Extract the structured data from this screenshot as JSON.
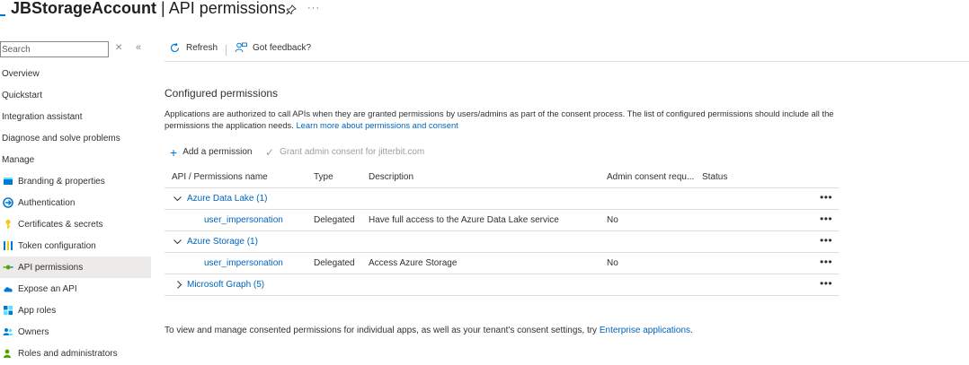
{
  "header": {
    "resource_name": "JBStorageAccount",
    "separator": " | ",
    "page_name": "API permissions",
    "more_label": "···"
  },
  "sidebar": {
    "search_placeholder": "Search",
    "items": [
      {
        "label": "Overview",
        "icon": "none"
      },
      {
        "label": "Quickstart",
        "icon": "none"
      },
      {
        "label": "Integration assistant",
        "icon": "none"
      },
      {
        "label": "Diagnose and solve problems",
        "icon": "none"
      },
      {
        "label": "Manage",
        "icon": "none"
      },
      {
        "label": "Branding & properties",
        "icon": "branding-icon"
      },
      {
        "label": "Authentication",
        "icon": "authentication-icon"
      },
      {
        "label": "Certificates & secrets",
        "icon": "key-icon"
      },
      {
        "label": "Token configuration",
        "icon": "token-icon"
      },
      {
        "label": "API permissions",
        "icon": "api-permissions-icon",
        "active": true
      },
      {
        "label": "Expose an API",
        "icon": "cloud-icon"
      },
      {
        "label": "App roles",
        "icon": "app-roles-icon"
      },
      {
        "label": "Owners",
        "icon": "owners-icon"
      },
      {
        "label": "Roles and administrators",
        "icon": "roles-icon"
      }
    ]
  },
  "toolbar": {
    "refresh_label": "Refresh",
    "feedback_label": "Got feedback?"
  },
  "main": {
    "section_title": "Configured permissions",
    "description": "Applications are authorized to call APIs when they are granted permissions by users/admins as part of the consent process. The list of configured permissions should include all the permissions the application needs. ",
    "learn_more_link": "Learn more about permissions and consent",
    "add_permission_label": "Add a permission",
    "grant_consent_label": "Grant admin consent for jitterbit.com",
    "table": {
      "headers": [
        "API / Permissions name",
        "Type",
        "Description",
        "Admin consent requ...",
        "Status"
      ],
      "rows": [
        {
          "kind": "group",
          "name": "Azure Data Lake (1)",
          "expanded": true
        },
        {
          "kind": "perm",
          "name": "user_impersonation",
          "type": "Delegated",
          "description": "Have full access to the Azure Data Lake service",
          "admin": "No",
          "status": ""
        },
        {
          "kind": "group",
          "name": "Azure Storage (1)",
          "expanded": true
        },
        {
          "kind": "perm",
          "name": "user_impersonation",
          "type": "Delegated",
          "description": "Access Azure Storage",
          "admin": "No",
          "status": ""
        },
        {
          "kind": "group",
          "name": "Microsoft Graph (5)",
          "expanded": false
        }
      ],
      "row_more_label": "•••"
    },
    "footer_text": "To view and manage consented permissions for individual apps, as well as your tenant's consent settings, try ",
    "footer_link": "Enterprise applications",
    "footer_end": "."
  },
  "colors": {
    "accent": "#0078d4",
    "link": "#0064bf",
    "active_bg": "#edebe9"
  }
}
